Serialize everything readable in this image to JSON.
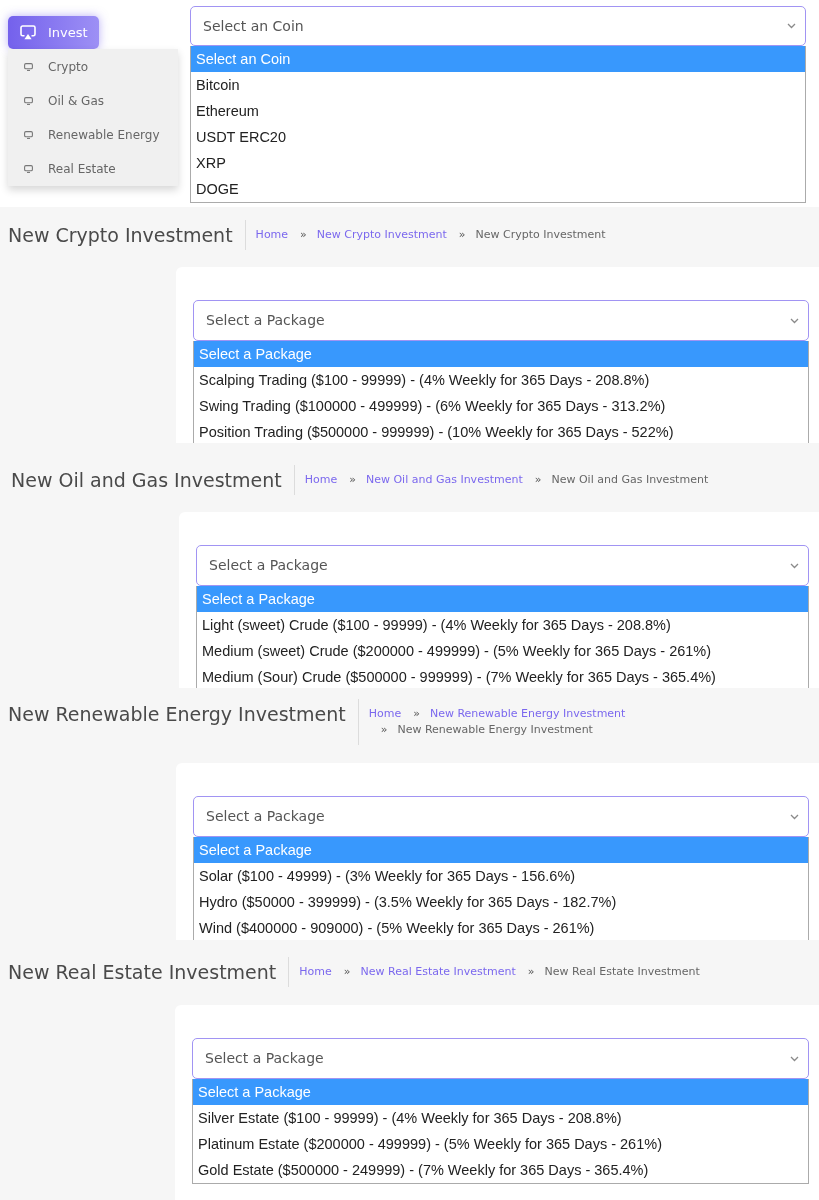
{
  "sidebar": {
    "menu": {
      "label": "Invest",
      "expanded": true
    },
    "submenu": [
      {
        "label": "Crypto"
      },
      {
        "label": "Oil & Gas"
      },
      {
        "label": "Renewable Energy"
      },
      {
        "label": "Real Estate"
      }
    ]
  },
  "coin_select": {
    "placeholder": "Select an Coin",
    "expanded": true,
    "options": [
      {
        "label": "Select an Coin",
        "selected": true
      },
      {
        "label": "Bitcoin",
        "selected": false
      },
      {
        "label": "Ethereum",
        "selected": false
      },
      {
        "label": "USDT ERC20",
        "selected": false
      },
      {
        "label": "XRP",
        "selected": false
      },
      {
        "label": "DOGE",
        "selected": false
      }
    ]
  },
  "sections": [
    {
      "title": "New Crypto Investment",
      "breadcrumb": [
        {
          "kind": "link",
          "text": "Home"
        },
        {
          "kind": "separator",
          "text": "»"
        },
        {
          "kind": "link",
          "text": "New Crypto Investment"
        },
        {
          "kind": "separator",
          "text": "»"
        },
        {
          "kind": "current",
          "text": "New Crypto Investment"
        }
      ],
      "package_select": {
        "placeholder": "Select a Package",
        "expanded": true,
        "options": [
          {
            "label": "Select a Package",
            "selected": true
          },
          {
            "label": "Scalping Trading ($100 - 99999) - (4% Weekly for 365 Days - 208.8%)",
            "selected": false
          },
          {
            "label": "Swing Trading ($100000 - 499999) - (6% Weekly for 365 Days - 313.2%)",
            "selected": false
          },
          {
            "label": "Position Trading ($500000 - 999999) - (10% Weekly for 365 Days - 522%)",
            "selected": false
          }
        ]
      }
    },
    {
      "title": "New Oil and Gas Investment",
      "breadcrumb": [
        {
          "kind": "link",
          "text": "Home"
        },
        {
          "kind": "separator",
          "text": "»"
        },
        {
          "kind": "link",
          "text": "New Oil and Gas Investment"
        },
        {
          "kind": "separator",
          "text": "»"
        },
        {
          "kind": "current",
          "text": "New Oil and Gas Investment"
        }
      ],
      "package_select": {
        "placeholder": "Select a Package",
        "expanded": true,
        "options": [
          {
            "label": "Select a Package",
            "selected": true
          },
          {
            "label": "Light (sweet) Crude ($100 - 99999) - (4% Weekly for 365 Days - 208.8%)",
            "selected": false
          },
          {
            "label": "Medium (sweet) Crude ($200000 - 499999) - (5% Weekly for 365 Days - 261%)",
            "selected": false
          },
          {
            "label": "Medium (Sour) Crude ($500000 - 999999) - (7% Weekly for 365 Days - 365.4%)",
            "selected": false
          }
        ]
      }
    },
    {
      "title": "New Renewable Energy Investment",
      "breadcrumb": [
        {
          "kind": "link",
          "text": "Home"
        },
        {
          "kind": "separator",
          "text": "»"
        },
        {
          "kind": "link",
          "text": "New Renewable Energy Investment"
        },
        {
          "kind": "separator",
          "text": "»"
        },
        {
          "kind": "current",
          "text": "New Renewable Energy Investment"
        }
      ],
      "package_select": {
        "placeholder": "Select a Package",
        "expanded": true,
        "options": [
          {
            "label": "Select a Package",
            "selected": true
          },
          {
            "label": "Solar ($100 - 49999) - (3% Weekly for 365 Days - 156.6%)",
            "selected": false
          },
          {
            "label": "Hydro ($50000 - 399999) - (3.5% Weekly for 365 Days - 182.7%)",
            "selected": false
          },
          {
            "label": "Wind ($400000 - 909000) - (5% Weekly for 365 Days - 261%)",
            "selected": false
          }
        ]
      }
    },
    {
      "title": "New Real Estate Investment",
      "breadcrumb": [
        {
          "kind": "link",
          "text": "Home"
        },
        {
          "kind": "separator",
          "text": "»"
        },
        {
          "kind": "link",
          "text": "New Real Estate Investment"
        },
        {
          "kind": "separator",
          "text": "»"
        },
        {
          "kind": "current",
          "text": "New Real Estate Investment"
        }
      ],
      "package_select": {
        "placeholder": "Select a Package",
        "expanded": true,
        "options": [
          {
            "label": "Select a Package",
            "selected": true
          },
          {
            "label": "Silver Estate ($100 - 99999) - (4% Weekly for 365 Days - 208.8%)",
            "selected": false
          },
          {
            "label": "Platinum Estate ($200000 - 499999) - (5% Weekly for 365 Days - 261%)",
            "selected": false
          },
          {
            "label": "Gold Estate ($500000 - 249999) - (7% Weekly for 365 Days - 365.4%)",
            "selected": false
          }
        ]
      }
    }
  ]
}
